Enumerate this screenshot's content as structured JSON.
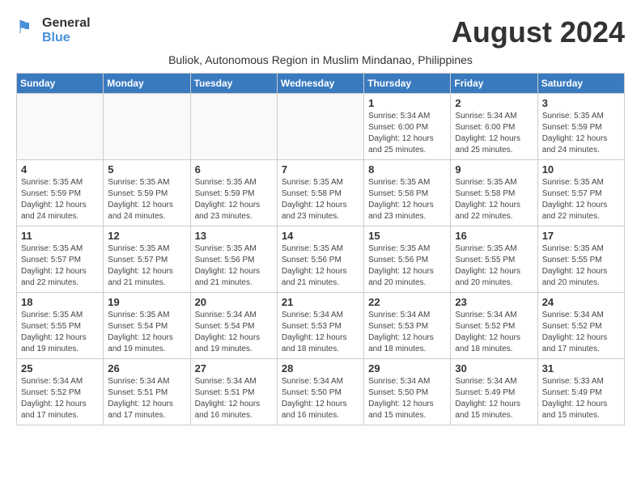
{
  "logo": {
    "general": "General",
    "blue": "Blue"
  },
  "header": {
    "month_year": "August 2024",
    "subtitle": "Buliok, Autonomous Region in Muslim Mindanao, Philippines"
  },
  "weekdays": [
    "Sunday",
    "Monday",
    "Tuesday",
    "Wednesday",
    "Thursday",
    "Friday",
    "Saturday"
  ],
  "weeks": [
    [
      {
        "day": "",
        "info": ""
      },
      {
        "day": "",
        "info": ""
      },
      {
        "day": "",
        "info": ""
      },
      {
        "day": "",
        "info": ""
      },
      {
        "day": "1",
        "info": "Sunrise: 5:34 AM\nSunset: 6:00 PM\nDaylight: 12 hours\nand 25 minutes."
      },
      {
        "day": "2",
        "info": "Sunrise: 5:34 AM\nSunset: 6:00 PM\nDaylight: 12 hours\nand 25 minutes."
      },
      {
        "day": "3",
        "info": "Sunrise: 5:35 AM\nSunset: 5:59 PM\nDaylight: 12 hours\nand 24 minutes."
      }
    ],
    [
      {
        "day": "4",
        "info": "Sunrise: 5:35 AM\nSunset: 5:59 PM\nDaylight: 12 hours\nand 24 minutes."
      },
      {
        "day": "5",
        "info": "Sunrise: 5:35 AM\nSunset: 5:59 PM\nDaylight: 12 hours\nand 24 minutes."
      },
      {
        "day": "6",
        "info": "Sunrise: 5:35 AM\nSunset: 5:59 PM\nDaylight: 12 hours\nand 23 minutes."
      },
      {
        "day": "7",
        "info": "Sunrise: 5:35 AM\nSunset: 5:58 PM\nDaylight: 12 hours\nand 23 minutes."
      },
      {
        "day": "8",
        "info": "Sunrise: 5:35 AM\nSunset: 5:58 PM\nDaylight: 12 hours\nand 23 minutes."
      },
      {
        "day": "9",
        "info": "Sunrise: 5:35 AM\nSunset: 5:58 PM\nDaylight: 12 hours\nand 22 minutes."
      },
      {
        "day": "10",
        "info": "Sunrise: 5:35 AM\nSunset: 5:57 PM\nDaylight: 12 hours\nand 22 minutes."
      }
    ],
    [
      {
        "day": "11",
        "info": "Sunrise: 5:35 AM\nSunset: 5:57 PM\nDaylight: 12 hours\nand 22 minutes."
      },
      {
        "day": "12",
        "info": "Sunrise: 5:35 AM\nSunset: 5:57 PM\nDaylight: 12 hours\nand 21 minutes."
      },
      {
        "day": "13",
        "info": "Sunrise: 5:35 AM\nSunset: 5:56 PM\nDaylight: 12 hours\nand 21 minutes."
      },
      {
        "day": "14",
        "info": "Sunrise: 5:35 AM\nSunset: 5:56 PM\nDaylight: 12 hours\nand 21 minutes."
      },
      {
        "day": "15",
        "info": "Sunrise: 5:35 AM\nSunset: 5:56 PM\nDaylight: 12 hours\nand 20 minutes."
      },
      {
        "day": "16",
        "info": "Sunrise: 5:35 AM\nSunset: 5:55 PM\nDaylight: 12 hours\nand 20 minutes."
      },
      {
        "day": "17",
        "info": "Sunrise: 5:35 AM\nSunset: 5:55 PM\nDaylight: 12 hours\nand 20 minutes."
      }
    ],
    [
      {
        "day": "18",
        "info": "Sunrise: 5:35 AM\nSunset: 5:55 PM\nDaylight: 12 hours\nand 19 minutes."
      },
      {
        "day": "19",
        "info": "Sunrise: 5:35 AM\nSunset: 5:54 PM\nDaylight: 12 hours\nand 19 minutes."
      },
      {
        "day": "20",
        "info": "Sunrise: 5:34 AM\nSunset: 5:54 PM\nDaylight: 12 hours\nand 19 minutes."
      },
      {
        "day": "21",
        "info": "Sunrise: 5:34 AM\nSunset: 5:53 PM\nDaylight: 12 hours\nand 18 minutes."
      },
      {
        "day": "22",
        "info": "Sunrise: 5:34 AM\nSunset: 5:53 PM\nDaylight: 12 hours\nand 18 minutes."
      },
      {
        "day": "23",
        "info": "Sunrise: 5:34 AM\nSunset: 5:52 PM\nDaylight: 12 hours\nand 18 minutes."
      },
      {
        "day": "24",
        "info": "Sunrise: 5:34 AM\nSunset: 5:52 PM\nDaylight: 12 hours\nand 17 minutes."
      }
    ],
    [
      {
        "day": "25",
        "info": "Sunrise: 5:34 AM\nSunset: 5:52 PM\nDaylight: 12 hours\nand 17 minutes."
      },
      {
        "day": "26",
        "info": "Sunrise: 5:34 AM\nSunset: 5:51 PM\nDaylight: 12 hours\nand 17 minutes."
      },
      {
        "day": "27",
        "info": "Sunrise: 5:34 AM\nSunset: 5:51 PM\nDaylight: 12 hours\nand 16 minutes."
      },
      {
        "day": "28",
        "info": "Sunrise: 5:34 AM\nSunset: 5:50 PM\nDaylight: 12 hours\nand 16 minutes."
      },
      {
        "day": "29",
        "info": "Sunrise: 5:34 AM\nSunset: 5:50 PM\nDaylight: 12 hours\nand 15 minutes."
      },
      {
        "day": "30",
        "info": "Sunrise: 5:34 AM\nSunset: 5:49 PM\nDaylight: 12 hours\nand 15 minutes."
      },
      {
        "day": "31",
        "info": "Sunrise: 5:33 AM\nSunset: 5:49 PM\nDaylight: 12 hours\nand 15 minutes."
      }
    ]
  ]
}
